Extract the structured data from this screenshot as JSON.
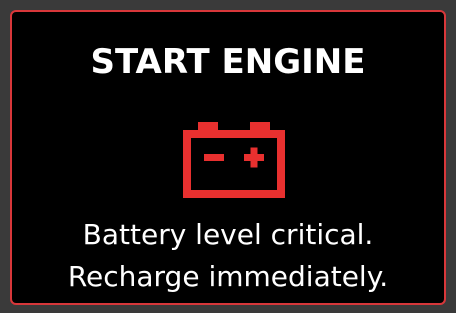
{
  "colors": {
    "background": "#000000",
    "frame": "#3a3a3a",
    "border": "#d8373a",
    "warning_icon": "#e8302f",
    "text": "#ffffff"
  },
  "warning": {
    "title": "START ENGINE",
    "icon": "battery-icon",
    "message_line1": "Battery level critical.",
    "message_line2": "Recharge immediately."
  }
}
